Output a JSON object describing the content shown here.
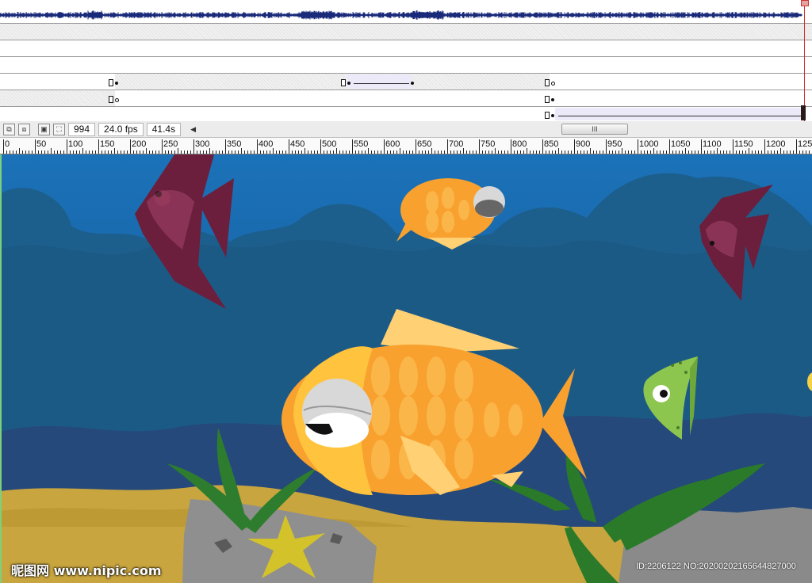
{
  "status_bar": {
    "frame": "994",
    "fps": "24.0 fps",
    "time": "41.4s",
    "scroll_left_arrow": "◀",
    "scroll_grip": "III"
  },
  "ruler": {
    "labels": [
      "0",
      "50",
      "100",
      "150",
      "200",
      "250",
      "300",
      "350",
      "400",
      "450",
      "500",
      "550",
      "600",
      "650",
      "700",
      "750",
      "800",
      "850",
      "900",
      "950",
      "1000",
      "1050",
      "1100",
      "1150",
      "1200",
      "125"
    ]
  },
  "stage": {
    "watermark_text": "昵图网 www.nipic.com",
    "image_id_text": "ID:2206122 NO:20200202165644827000"
  },
  "colors": {
    "water_top": "#1b6fb5",
    "water_deep": "#1d5a85",
    "sand": "#c9a53f",
    "goldfish": "#f8a12f",
    "angelfish": "#6b1f3c",
    "green_fish": "#8dc64e",
    "seaweed": "#2a7a2a",
    "playhead": "#d92b2b"
  }
}
